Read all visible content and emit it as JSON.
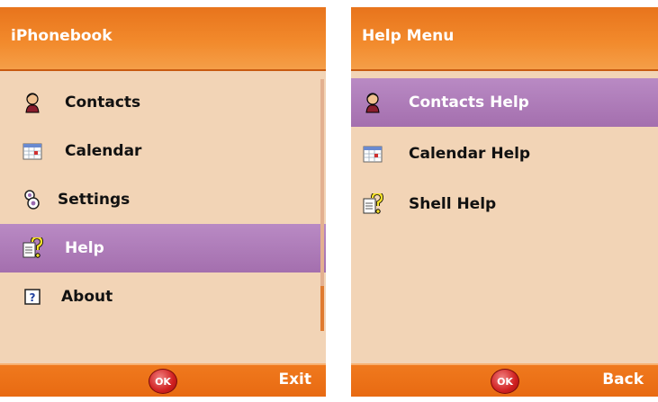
{
  "screen1": {
    "title": "iPhonebook",
    "items": [
      {
        "label": "Contacts",
        "icon": "contact-person-icon"
      },
      {
        "label": "Calendar",
        "icon": "calendar-icon"
      },
      {
        "label": "Settings",
        "icon": "settings-icon"
      },
      {
        "label": "Help",
        "icon": "help-document-icon",
        "selected": true
      },
      {
        "label": "About",
        "icon": "about-question-icon"
      }
    ],
    "softkeys": {
      "center": "OK",
      "right": "Exit"
    }
  },
  "screen2": {
    "title": "Help Menu",
    "items": [
      {
        "label": "Contacts Help",
        "icon": "contact-person-icon",
        "selected": true
      },
      {
        "label": "Calendar Help",
        "icon": "calendar-icon"
      },
      {
        "label": "Shell Help",
        "icon": "help-document-icon"
      }
    ],
    "softkeys": {
      "center": "OK",
      "right": "Back"
    }
  },
  "colors": {
    "title_bar": "#f28a2c",
    "background": "#f2d4b6",
    "selection": "#a46fae"
  }
}
